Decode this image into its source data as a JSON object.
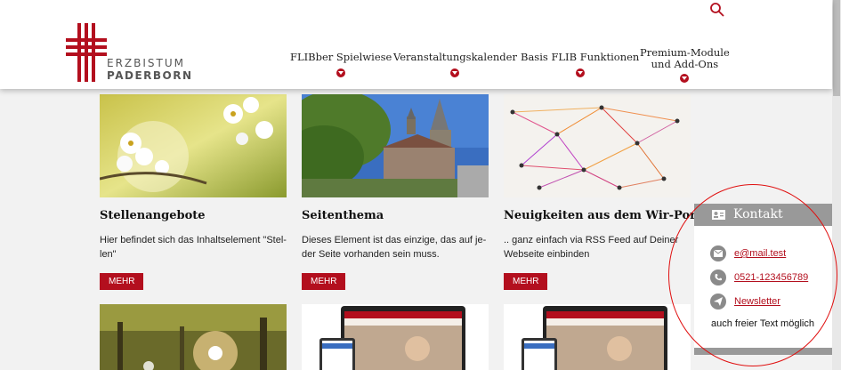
{
  "header": {
    "logo_line1": "ERZBISTUM",
    "logo_line2": "PADERBORN",
    "nav": [
      {
        "label": "FLIBber Spielwiese"
      },
      {
        "label": "Veranstaltungskalender"
      },
      {
        "label": "Basis FLIB Funktionen"
      },
      {
        "label_line1": "Premium-Module",
        "label_line2": "und Add-Ons"
      }
    ]
  },
  "cards": [
    {
      "title": "Stellenangebote",
      "text": "Hier befindet sich das Inhaltselement \"Stel-len\"",
      "button": "MEHR"
    },
    {
      "title": "Seitenthema",
      "text": "Dieses Element ist das einzige, das auf je-der Seite vorhanden sein muss.",
      "button": "MEHR"
    },
    {
      "title": "Neuigkeiten aus dem Wir-Portal",
      "text": ".. ganz einfach via RSS Feed auf Deiner Webseite einbinden",
      "button": "MEHR"
    }
  ],
  "kontakt": {
    "title": "Kontakt",
    "email": "e@mail.test",
    "phone": "0521-123456789",
    "newsletter": "Newsletter",
    "free_text": "auch freier Text möglich"
  },
  "colors": {
    "accent": "#b30f1e",
    "kontakt_gray": "#999999",
    "annotation": "#e01010"
  }
}
